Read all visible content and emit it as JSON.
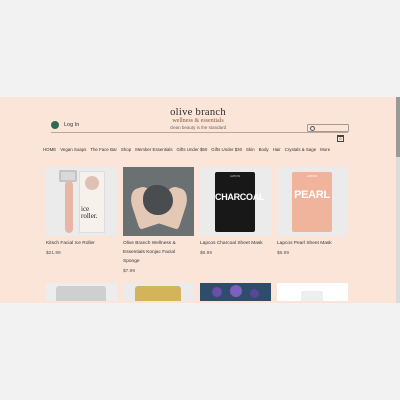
{
  "header": {
    "login_label": "Log In",
    "brand_name": "olive branch",
    "brand_sub": "wellness & essentials",
    "tagline": "clean beauty is the standard",
    "search_placeholder": "Search",
    "cart_count": "0"
  },
  "nav": [
    "HOME",
    "Vegan Soaps",
    "The Face Bar",
    "Shop",
    "Member Essentials",
    "Gifts Under $50",
    "Gifts Under $30",
    "Skin",
    "Body",
    "Hair",
    "Crystals & Sage",
    "More"
  ],
  "products": [
    {
      "name": "Kitsch Facial Ice Roller",
      "price": "$21.99",
      "box_text": "ice roller."
    },
    {
      "name_lines": [
        "Olive Branch Wellness &",
        "Essentials Konjac Facial",
        "Sponge"
      ],
      "price": "$7.99"
    },
    {
      "name": "Lapcos Charcoal Sheet Mask",
      "price": "$6.99",
      "pack_text": "CHARCOAL",
      "pack_brand": "LAPCOS"
    },
    {
      "name": "Lapcos Pearl Sheet Mask",
      "price": "$6.99",
      "pack_text": "PEARL",
      "pack_brand": "LAPCOS"
    }
  ],
  "icons": [
    "user-icon",
    "search-icon",
    "cart-icon"
  ],
  "colors": {
    "site_bg": "#fbe5d8",
    "accent": "#2f6b52"
  }
}
